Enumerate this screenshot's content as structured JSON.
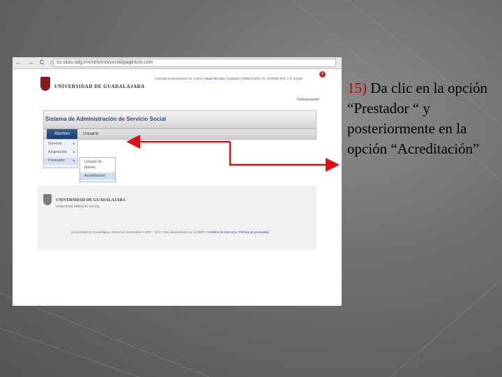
{
  "browser": {
    "url": "ss.siiau.udg.mx/servicio/social/paginicio.com",
    "nav_icons": "← → C ⌂"
  },
  "site": {
    "logo_text": "UNIVERSIDAD DE GUADALAJARA",
    "top_links": {
      "prefix": "Consulta la información en:",
      "items": [
        "Inicio",
        "Mapa del sitio",
        "Contacto"
      ],
      "suffix": "DIRECCIÓN: AV. JUÁREZ 976, C.P. 44100"
    },
    "contact": "Comunicación",
    "system_title": "Sistema de Administración de Servicio Social",
    "menu": {
      "active": "Alumno",
      "other": "Usuario"
    },
    "dropdown": {
      "items": [
        "General",
        "Asignación",
        "Prestador"
      ]
    },
    "submenu": {
      "items": [
        "Listado de plazas",
        "Acreditación"
      ]
    },
    "footer": {
      "logo_line1": "UNIVERSIDAD DE GUADALAJARA",
      "logo_line2": "UNIDAD DE SERVICIO SOCIAL",
      "copyright": "Universidad de Guadalajara. Derechos reservados ©1997 - 2010. Sitio desarrollado por la",
      "copyright_link": "CGTI | Créditos de este sitio | Política de privacidad"
    }
  },
  "instruction": {
    "number": "15)",
    "text": " Da clic en la opción “Prestador “ y posteriormente en la opción “Acreditación”"
  },
  "colors": {
    "arrow": "#e01010",
    "instruction_number": "#c00000",
    "menu_active": "#1c3f6e"
  }
}
